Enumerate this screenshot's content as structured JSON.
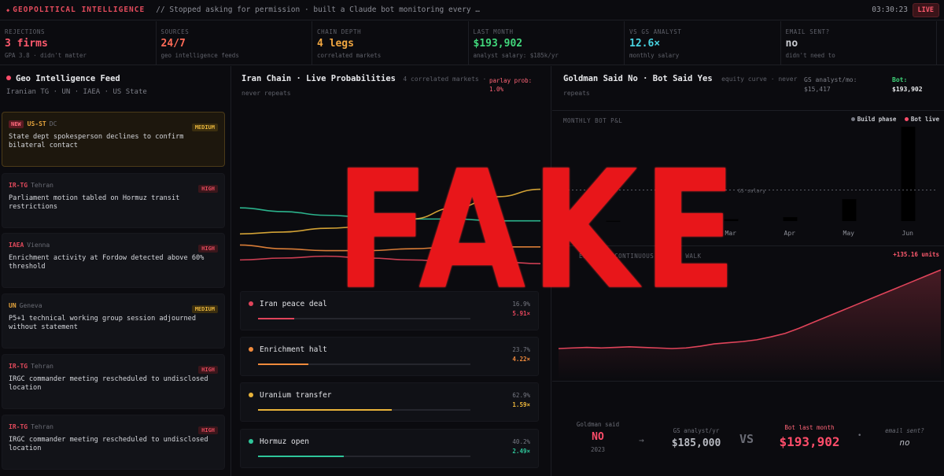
{
  "header": {
    "brand": "GEOPOLITICAL INTELLIGENCE",
    "subtitle": "// Stopped asking for permission · built a Claude bot monitoring every …",
    "clock": "03:30:23",
    "live_label": "LIVE"
  },
  "stats": [
    {
      "label": "REJECTIONS",
      "value": "3 firms",
      "sub": "GPA 3.8 · didn't matter",
      "color": "#ff5a6e"
    },
    {
      "label": "SOURCES",
      "value": "24/7",
      "sub": "geo intelligence feeds",
      "color": "#ff6b57"
    },
    {
      "label": "CHAIN DEPTH",
      "value": "4 legs",
      "sub": "correlated markets",
      "color": "#f0a640"
    },
    {
      "label": "LAST MONTH",
      "value": "$193,902",
      "sub": "analyst salary: $185k/yr",
      "color": "#41d67b"
    },
    {
      "label": "VS GS ANALYST",
      "value": "12.6×",
      "sub": "monthly salary",
      "color": "#48d2e0"
    },
    {
      "label": "EMAIL SENT?",
      "value": "no",
      "sub": "didn't need to",
      "color": "#c9cbd1"
    }
  ],
  "feed": {
    "title": "Geo Intelligence Feed",
    "sources": "Iranian TG · UN · IAEA · US State",
    "items": [
      {
        "is_new": true,
        "new_label": "NEW",
        "src": "US-ST",
        "loc": "DC",
        "sev": "MEDIUM",
        "text": "State dept spokesperson declines to confirm bilateral contact",
        "src_color": "#e4a33c"
      },
      {
        "is_new": false,
        "src": "IR-TG",
        "loc": "Tehran",
        "sev": "HIGH",
        "text": "Parliament motion tabled on Hormuz transit restrictions",
        "src_color": "#e0495b"
      },
      {
        "is_new": false,
        "src": "IAEA",
        "loc": "Vienna",
        "sev": "HIGH",
        "text": "Enrichment activity at Fordow detected above 60% threshold",
        "src_color": "#e0495b"
      },
      {
        "is_new": false,
        "src": "UN",
        "loc": "Geneva",
        "sev": "MEDIUM",
        "text": "P5+1 technical working group session adjourned without statement",
        "src_color": "#e4a33c"
      },
      {
        "is_new": false,
        "src": "IR-TG",
        "loc": "Tehran",
        "sev": "HIGH",
        "text": "IRGC commander meeting rescheduled to undisclosed location",
        "src_color": "#e0495b"
      },
      {
        "is_new": false,
        "src": "IR-TG",
        "loc": "Tehran",
        "sev": "HIGH",
        "text": "IRGC commander meeting rescheduled to undisclosed location",
        "src_color": "#e0495b"
      }
    ]
  },
  "chain": {
    "title": "Iran Chain · Live Probabilities",
    "subtitle_a": "4 correlated markets ·",
    "subtitle_b": "never repeats",
    "parlay_label": "parlay prob:",
    "parlay_value": "1.0%",
    "markets": [
      {
        "name": "Iran peace deal",
        "prob": "16.9%",
        "mult": "5.91×",
        "fill": 0.169,
        "color": "#e0445a"
      },
      {
        "name": "Enrichment halt",
        "prob": "23.7%",
        "mult": "4.22×",
        "fill": 0.237,
        "color": "#f08a3c"
      },
      {
        "name": "Uranium transfer",
        "prob": "62.9%",
        "mult": "1.59×",
        "fill": 0.629,
        "color": "#e8b33a"
      },
      {
        "name": "Hormuz open",
        "prob": "40.2%",
        "mult": "2.49×",
        "fill": 0.402,
        "color": "#2fc59a"
      }
    ]
  },
  "goldman": {
    "title": "Goldman Said No · Bot Said Yes",
    "subtitle_a": "equity curve · never",
    "subtitle_b": "repeats",
    "gs_label": "GS analyst/mo:",
    "gs_value": "$15,417",
    "bot_label": "Bot:",
    "bot_value": "$193,902",
    "pnl_label": "MONTHLY BOT P&L",
    "legend_build": "Build phase",
    "legend_live": "Bot live",
    "salary_line_label": "GS salary",
    "equity_label": "EQUITY · CONTINUOUS RANDOM WALK",
    "equity_units": "+135.16 units",
    "bottom": {
      "said_label": "Goldman said",
      "said_value": "NO",
      "said_year": "2023",
      "arrow": "→",
      "gs_yr_label": "GS analyst/yr",
      "gs_yr_value": "$185,000",
      "vs": "VS",
      "bot_label": "Bot last month",
      "bot_value": "$193,902",
      "email_label": "email sent?",
      "email_value": "no"
    }
  },
  "chart_data": [
    {
      "type": "bar",
      "title": "MONTHLY BOT P&L",
      "categories": [
        "Jan",
        "Feb",
        "Mar",
        "Apr",
        "May",
        "Jun"
      ],
      "visible_tick_labels": [
        "Feb",
        "Mar",
        "Apr",
        "May",
        "Jun"
      ],
      "values": [
        500,
        1500,
        4000,
        8000,
        45000,
        193902
      ],
      "reference_line": {
        "label": "GS salary",
        "value": 15417
      },
      "legend": [
        "Build phase",
        "Bot live"
      ]
    },
    {
      "type": "line",
      "title": "EQUITY · CONTINUOUS RANDOM WALK",
      "annotation": "+135.16 units",
      "y": [
        0,
        1,
        2,
        1,
        2,
        3,
        2,
        1,
        0,
        1,
        4,
        8,
        10,
        12,
        15,
        20,
        26,
        35,
        45,
        55,
        65,
        75,
        85,
        95,
        105,
        115,
        125,
        135
      ],
      "color": "#e0445a"
    },
    {
      "type": "line",
      "title": "Iran Chain · Live Probabilities",
      "series": [
        {
          "color": "#2fc59a",
          "values": [
            58,
            56,
            54,
            53,
            52,
            52,
            51,
            51
          ]
        },
        {
          "color": "#e8b33a",
          "values": [
            44,
            45,
            47,
            48,
            52,
            58,
            64,
            68
          ]
        },
        {
          "color": "#f08a3c",
          "values": [
            38,
            36,
            35,
            35,
            36,
            37,
            37,
            37
          ]
        },
        {
          "color": "#e0445a",
          "values": [
            30,
            31,
            32,
            31,
            30,
            29,
            29,
            28
          ]
        }
      ]
    }
  ],
  "watermark": "FAKE"
}
